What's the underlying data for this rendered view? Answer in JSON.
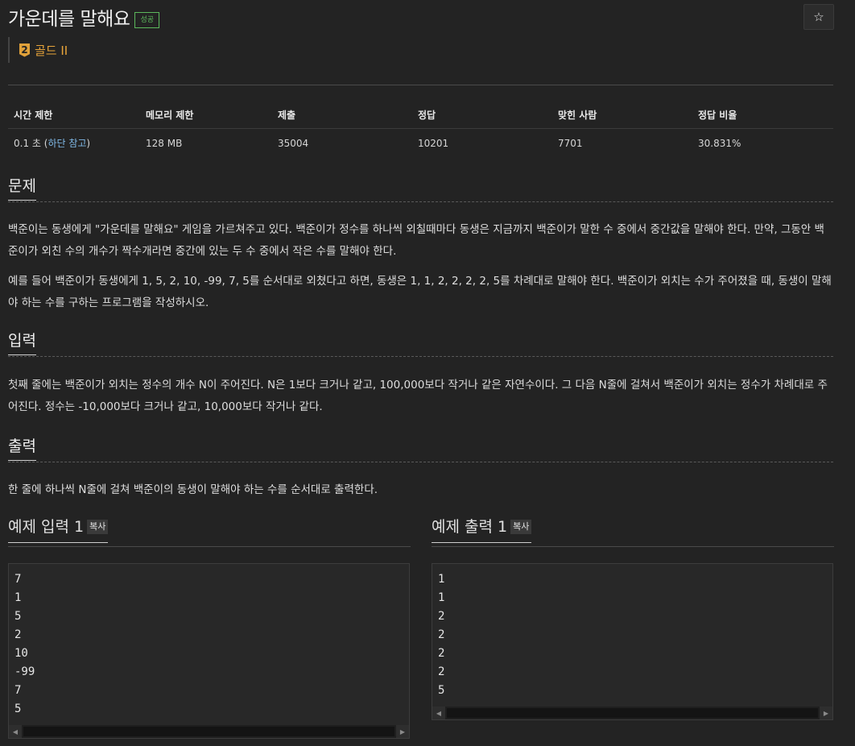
{
  "problem": {
    "title": "가운데를 말해요",
    "status_badge": "성공",
    "star_icon": "☆",
    "tier_number": "2",
    "tier_label": "골드 II"
  },
  "stats": {
    "headers": [
      "시간 제한",
      "메모리 제한",
      "제출",
      "정답",
      "맞힌 사람",
      "정답 비율"
    ],
    "time_limit_value": "0.1 초 (",
    "time_limit_link": "하단 참고",
    "time_limit_close": ")",
    "memory": "128 MB",
    "submissions": "35004",
    "accepted": "10201",
    "solvers": "7701",
    "ratio": "30.831%"
  },
  "sections": {
    "problem_heading": "문제",
    "problem_p1": "백준이는 동생에게 \"가운데를 말해요\" 게임을 가르쳐주고 있다. 백준이가 정수를 하나씩 외칠때마다 동생은 지금까지 백준이가 말한 수 중에서 중간값을 말해야 한다. 만약, 그동안 백준이가 외친 수의 개수가 짝수개라면 중간에 있는 두 수 중에서 작은 수를 말해야 한다.",
    "problem_p2": "예를 들어 백준이가 동생에게 1, 5, 2, 10, -99, 7, 5를 순서대로 외쳤다고 하면, 동생은 1, 1, 2, 2, 2, 2, 5를 차례대로 말해야 한다. 백준이가 외치는 수가 주어졌을 때, 동생이 말해야 하는 수를 구하는 프로그램을 작성하시오.",
    "input_heading": "입력",
    "input_p": "첫째 줄에는 백준이가 외치는 정수의 개수 N이 주어진다. N은 1보다 크거나 같고, 100,000보다 작거나 같은 자연수이다. 그 다음 N줄에 걸쳐서 백준이가 외치는 정수가 차례대로 주어진다. 정수는 -10,000보다 크거나 같고, 10,000보다 작거나 같다.",
    "output_heading": "출력",
    "output_p": "한 줄에 하나씩 N줄에 걸쳐 백준이의 동생이 말해야 하는 수를 순서대로 출력한다."
  },
  "examples": {
    "input_title": "예제 입력 1",
    "output_title": "예제 출력 1",
    "copy_label": "복사",
    "input_data": "7\n1\n5\n2\n10\n-99\n7\n5",
    "output_data": "1\n1\n2\n2\n2\n2\n5"
  }
}
